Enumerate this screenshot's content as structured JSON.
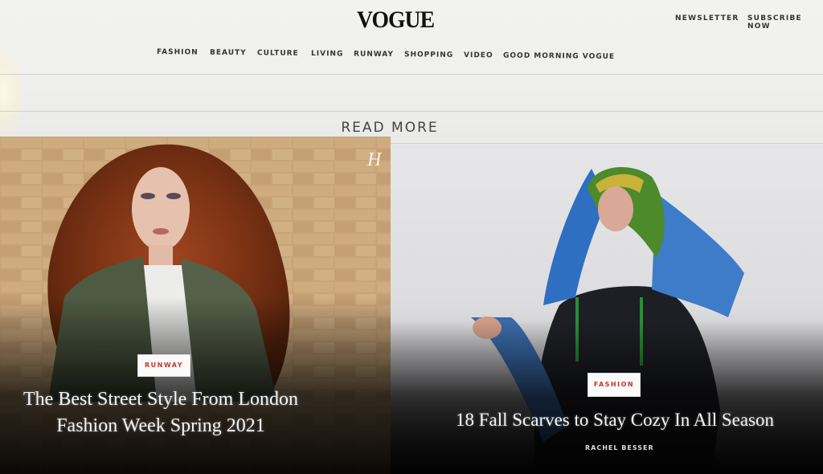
{
  "header": {
    "logo": "VOGUE",
    "newsletter_label": "NEWSLETTER",
    "subscribe_label": "SUBSCRIBE NOW"
  },
  "nav": {
    "items": [
      "FASHION",
      "BEAUTY",
      "CULTURE",
      "LIVING",
      "RUNWAY",
      "SHOPPING",
      "VIDEO",
      "GOOD MORNING VOGUE"
    ]
  },
  "read_more": "READ MORE",
  "overlay_letter": "H",
  "articles": [
    {
      "tag": "RUNWAY",
      "title_line1": "The Best Street Style From London",
      "title_line2": "Fashion Week Spring 2021",
      "image": "woman-with-voluminous-red-hair-green-bomber-jacket"
    },
    {
      "tag": "FASHION",
      "title": "18 Fall Scarves to Stay Cozy In All Season",
      "byline": "RACHEL BESSER",
      "image": "person-wrapped-in-blue-and-green-scarves"
    }
  ],
  "colors": {
    "tag_text": "#c0392b",
    "page_bg": "#f2f2f0"
  }
}
